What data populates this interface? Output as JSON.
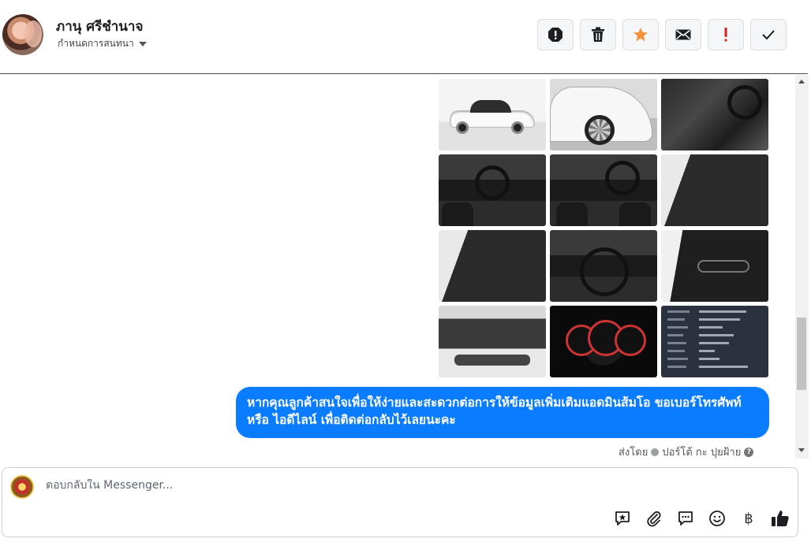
{
  "header": {
    "contact_name": "ภานุ ศรีชำนาจ",
    "conversation_settings": "กำหนดการสนทนา",
    "actions": [
      {
        "name": "spam-icon",
        "color": "#1c1e21"
      },
      {
        "name": "trash-icon",
        "color": "#1c1e21"
      },
      {
        "name": "star-icon",
        "color": "#f7923a"
      },
      {
        "name": "mail-icon",
        "color": "#1c1e21"
      },
      {
        "name": "important-icon",
        "color": "#e02020"
      },
      {
        "name": "check-icon",
        "color": "#1c1e21"
      }
    ]
  },
  "thread": {
    "message": "หากคุณลูกค้าสนใจเพื่อให้ง่ายและสะดวกต่อการให้ข้อมูลเพิ่มเติมแอดมินส้มโอ ขอเบอร์โทรศัพท์ หรือ ไอดีไลน์ เพื่อติดต่อกลับไว้เลยนะคะ",
    "sent_by_prefix": "ส่งโดย",
    "sent_by_name": "ปอร์โต้ กะ ปุยฝ้าย",
    "bubble_color": "#0a7cff"
  },
  "composer": {
    "placeholder": "ตอบกลับใน Messenger...",
    "currency_symbol": "฿"
  }
}
